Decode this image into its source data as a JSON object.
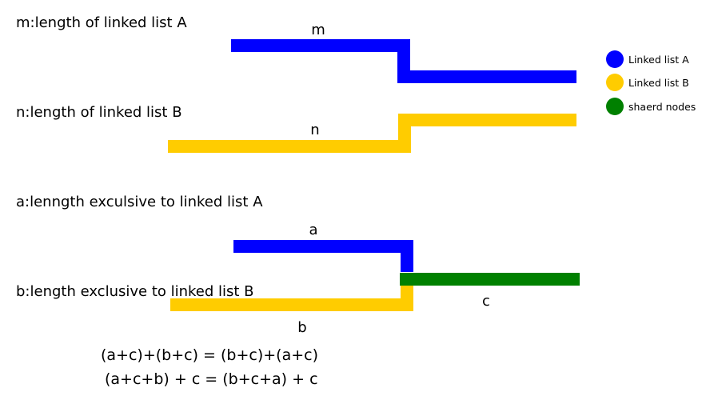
{
  "colors": {
    "list_a": "#0000ff",
    "list_b": "#ffcc00",
    "shared": "#008000"
  },
  "definitions": {
    "m": "m:length of linked list A",
    "n": "n:length of linked list B",
    "a": "a:lenngth exculsive to linked list A",
    "b": "b:length exclusive to linked list B"
  },
  "segment_labels": {
    "m": "m",
    "n": "n",
    "a": "a",
    "b": "b",
    "c": "c"
  },
  "equations": [
    "(a+c)+(b+c) = (b+c)+(a+c)",
    "(a+c+b) + c = (b+c+a) + c"
  ],
  "legend": [
    {
      "label": "Linked list A",
      "color": "#0000ff"
    },
    {
      "label": "Linked list B",
      "color": "#ffcc00"
    },
    {
      "label": "shaerd nodes",
      "color": "#008000"
    }
  ]
}
